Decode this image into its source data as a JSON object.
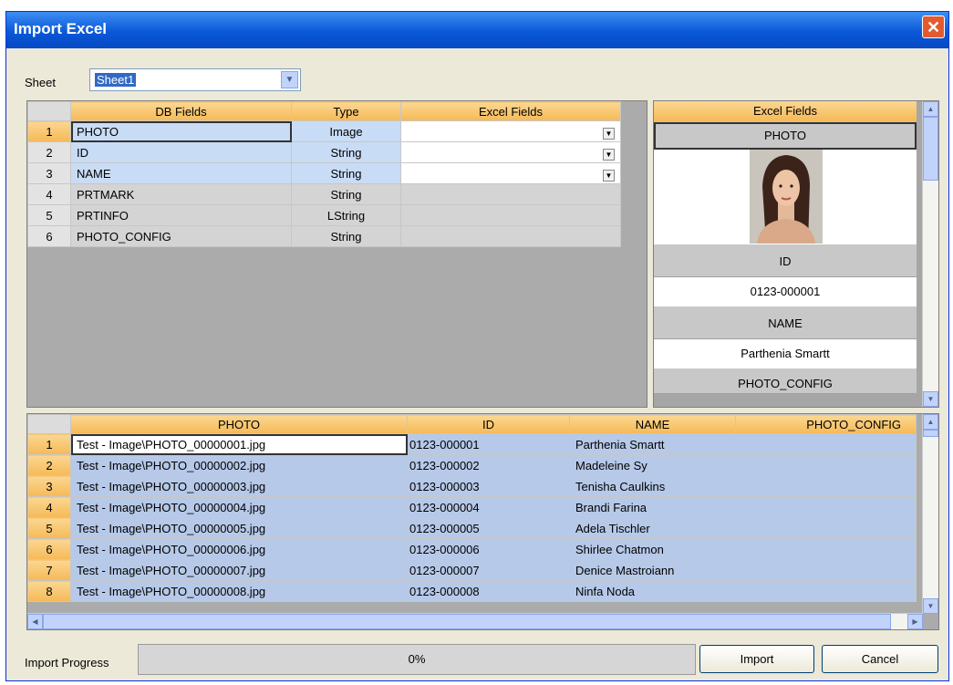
{
  "window": {
    "title": "Import Excel",
    "close_glyph": "✕"
  },
  "sheet": {
    "label": "Sheet",
    "value": "Sheet1",
    "arrow": "▼"
  },
  "mapping": {
    "headers": [
      "DB Fields",
      "Type",
      "Excel Fields"
    ],
    "rows": [
      {
        "num": "1",
        "field": "PHOTO",
        "type": "Image",
        "excel": ""
      },
      {
        "num": "2",
        "field": "ID",
        "type": "String",
        "excel": ""
      },
      {
        "num": "3",
        "field": "NAME",
        "type": "String",
        "excel": ""
      },
      {
        "num": "4",
        "field": "PRTMARK",
        "type": "String",
        "excel": ""
      },
      {
        "num": "5",
        "field": "PRTINFO",
        "type": "LString",
        "excel": ""
      },
      {
        "num": "6",
        "field": "PHOTO_CONFIG",
        "type": "String",
        "excel": ""
      }
    ]
  },
  "preview": {
    "header": "Excel Fields",
    "photo_label": "PHOTO",
    "id_label": "ID",
    "id_value": "0123-000001",
    "name_label": "NAME",
    "name_value": "Parthenia Smartt",
    "config_label": "PHOTO_CONFIG"
  },
  "data_grid": {
    "headers": [
      "PHOTO",
      "ID",
      "NAME",
      "PHOTO_CONFIG"
    ],
    "rows": [
      {
        "num": "1",
        "photo": "Test - Image\\PHOTO_00000001.jpg",
        "id": "0123-000001",
        "name": "Parthenia Smartt",
        "config": ""
      },
      {
        "num": "2",
        "photo": "Test - Image\\PHOTO_00000002.jpg",
        "id": "0123-000002",
        "name": "Madeleine Sy",
        "config": ""
      },
      {
        "num": "3",
        "photo": "Test - Image\\PHOTO_00000003.jpg",
        "id": "0123-000003",
        "name": "Tenisha Caulkins",
        "config": ""
      },
      {
        "num": "4",
        "photo": "Test - Image\\PHOTO_00000004.jpg",
        "id": "0123-000004",
        "name": "Brandi Farina",
        "config": ""
      },
      {
        "num": "5",
        "photo": "Test - Image\\PHOTO_00000005.jpg",
        "id": "0123-000005",
        "name": "Adela Tischler",
        "config": ""
      },
      {
        "num": "6",
        "photo": "Test - Image\\PHOTO_00000006.jpg",
        "id": "0123-000006",
        "name": "Shirlee Chatmon",
        "config": ""
      },
      {
        "num": "7",
        "photo": "Test - Image\\PHOTO_00000007.jpg",
        "id": "0123-000007",
        "name": "Denice Mastroiann",
        "config": ""
      },
      {
        "num": "8",
        "photo": "Test - Image\\PHOTO_00000008.jpg",
        "id": "0123-000008",
        "name": "Ninfa Noda",
        "config": ""
      }
    ]
  },
  "progress": {
    "label": "Import Progress",
    "text": "0%",
    "fraction": 0
  },
  "buttons": {
    "import": "Import",
    "cancel": "Cancel"
  },
  "scroll_glyphs": {
    "up": "▲",
    "down": "▼",
    "left": "◀",
    "right": "▶"
  },
  "colors": {
    "header_orange": "#f5b957",
    "selection_blue": "#316ac5",
    "title_blue": "#0a58d8",
    "row_blue": "#b7c9e8"
  }
}
